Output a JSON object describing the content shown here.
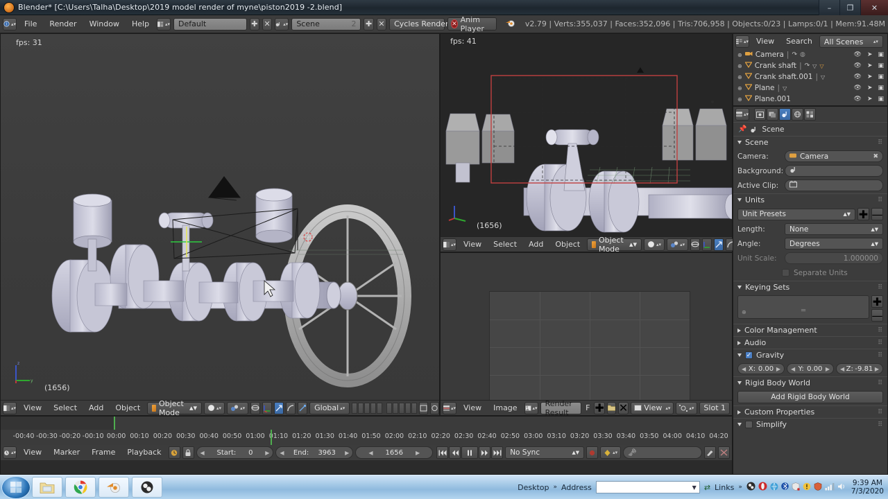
{
  "window": {
    "title": "Blender* [C:\\Users\\Talha\\Desktop\\2019 model render of myne\\piston2019 -2.blend]",
    "minimize": "–",
    "maximize": "❐",
    "close": "✕"
  },
  "topbar": {
    "menus": [
      "File",
      "Render",
      "Window",
      "Help"
    ],
    "screen_layout": "Default",
    "scene_name": "Scene",
    "scene_users": "2",
    "engine": "Cycles Render",
    "anim_player": "Anim Player",
    "stats": "v2.79 | Verts:355,037 | Faces:352,096 | Tris:706,958 | Objects:0/23 | Lamps:0/1 | Mem:91.48M",
    "add_icon": "✚",
    "unlink_icon": "✕"
  },
  "viewport_left": {
    "fps": "fps: 31",
    "frame": "(1656)",
    "header": {
      "menus": [
        "View",
        "Select",
        "Add",
        "Object"
      ],
      "mode": "Object Mode",
      "orientation": "Global"
    }
  },
  "viewport_right": {
    "fps": "fps: 41",
    "frame": "(1656)",
    "header": {
      "menus": [
        "View",
        "Select",
        "Add",
        "Object"
      ],
      "mode": "Object Mode"
    }
  },
  "image_editor": {
    "menus": [
      "View",
      "Image"
    ],
    "image_name": "Render Result",
    "fake_user": "F",
    "add_icon": "✚",
    "view_label": "View",
    "slot_label": "Slot 1"
  },
  "outliner": {
    "menus": [
      "View",
      "Search"
    ],
    "display_mode": "All Scenes",
    "items": [
      {
        "label": "Camera",
        "type": "camera"
      },
      {
        "label": "Crank shaft",
        "type": "mesh"
      },
      {
        "label": "Crank shaft.001",
        "type": "mesh"
      },
      {
        "label": "Plane",
        "type": "mesh"
      },
      {
        "label": "Plane.001",
        "type": "mesh"
      }
    ]
  },
  "properties": {
    "breadcrumb": "Scene",
    "tabs": [
      "render",
      "render-layers",
      "scene",
      "world",
      "object"
    ],
    "active_tab": "scene",
    "sections": {
      "scene": {
        "title": "Scene",
        "camera_label": "Camera:",
        "camera_value": "Camera",
        "background_label": "Background:",
        "background_value": "",
        "active_clip_label": "Active Clip:",
        "active_clip_value": ""
      },
      "units": {
        "title": "Units",
        "presets_label": "Unit Presets",
        "length_label": "Length:",
        "length_value": "None",
        "angle_label": "Angle:",
        "angle_value": "Degrees",
        "unit_scale_label": "Unit Scale:",
        "unit_scale_value": "1.000000",
        "separate_units_label": "Separate Units"
      },
      "keying_sets": {
        "title": "Keying Sets"
      },
      "color_management": {
        "title": "Color Management"
      },
      "audio": {
        "title": "Audio"
      },
      "gravity": {
        "title": "Gravity",
        "x_label": "X:",
        "x_value": "0.00",
        "y_label": "Y:",
        "y_value": "0.00",
        "z_label": "Z:",
        "z_value": "-9.81"
      },
      "rigid_body_world": {
        "title": "Rigid Body World",
        "button": "Add Rigid Body World"
      },
      "custom_properties": {
        "title": "Custom Properties"
      },
      "simplify": {
        "title": "Simplify"
      }
    }
  },
  "timeline": {
    "menus": [
      "View",
      "Marker",
      "Frame",
      "Playback"
    ],
    "start_label": "Start:",
    "start_value": "0",
    "end_label": "End:",
    "end_value": "3963",
    "current_frame": "1656",
    "sync_mode": "No Sync",
    "ruler_ticks": [
      "-00:40",
      "-00:30",
      "-00:20",
      "-00:10",
      "00:00",
      "00:10",
      "00:20",
      "00:30",
      "00:40",
      "00:50",
      "01:00",
      "01:10",
      "01:20",
      "01:30",
      "01:40",
      "01:50",
      "02:00",
      "02:10",
      "02:20",
      "02:30",
      "02:40",
      "02:50",
      "03:00",
      "03:10",
      "03:20",
      "03:30",
      "03:40",
      "03:50",
      "04:00",
      "04:10",
      "04:20"
    ]
  },
  "taskbar": {
    "apps": [
      "start",
      "file-explorer",
      "chrome",
      "blender",
      "obs"
    ],
    "desktop_label": "Desktop",
    "address_label": "Address",
    "links_label": "Links",
    "chevron": "»",
    "time": "9:39 AM",
    "date": "7/3/2020"
  },
  "colors": {
    "blender_header": "#3c3c3c",
    "viewport_bg": "#3e3e3e",
    "accent_blue": "#4a7fc0",
    "accent_orange": "#e08b2a",
    "model_grey": "#c3c3d2",
    "playhead_green": "#4fae4f",
    "select_red": "#c04040"
  }
}
